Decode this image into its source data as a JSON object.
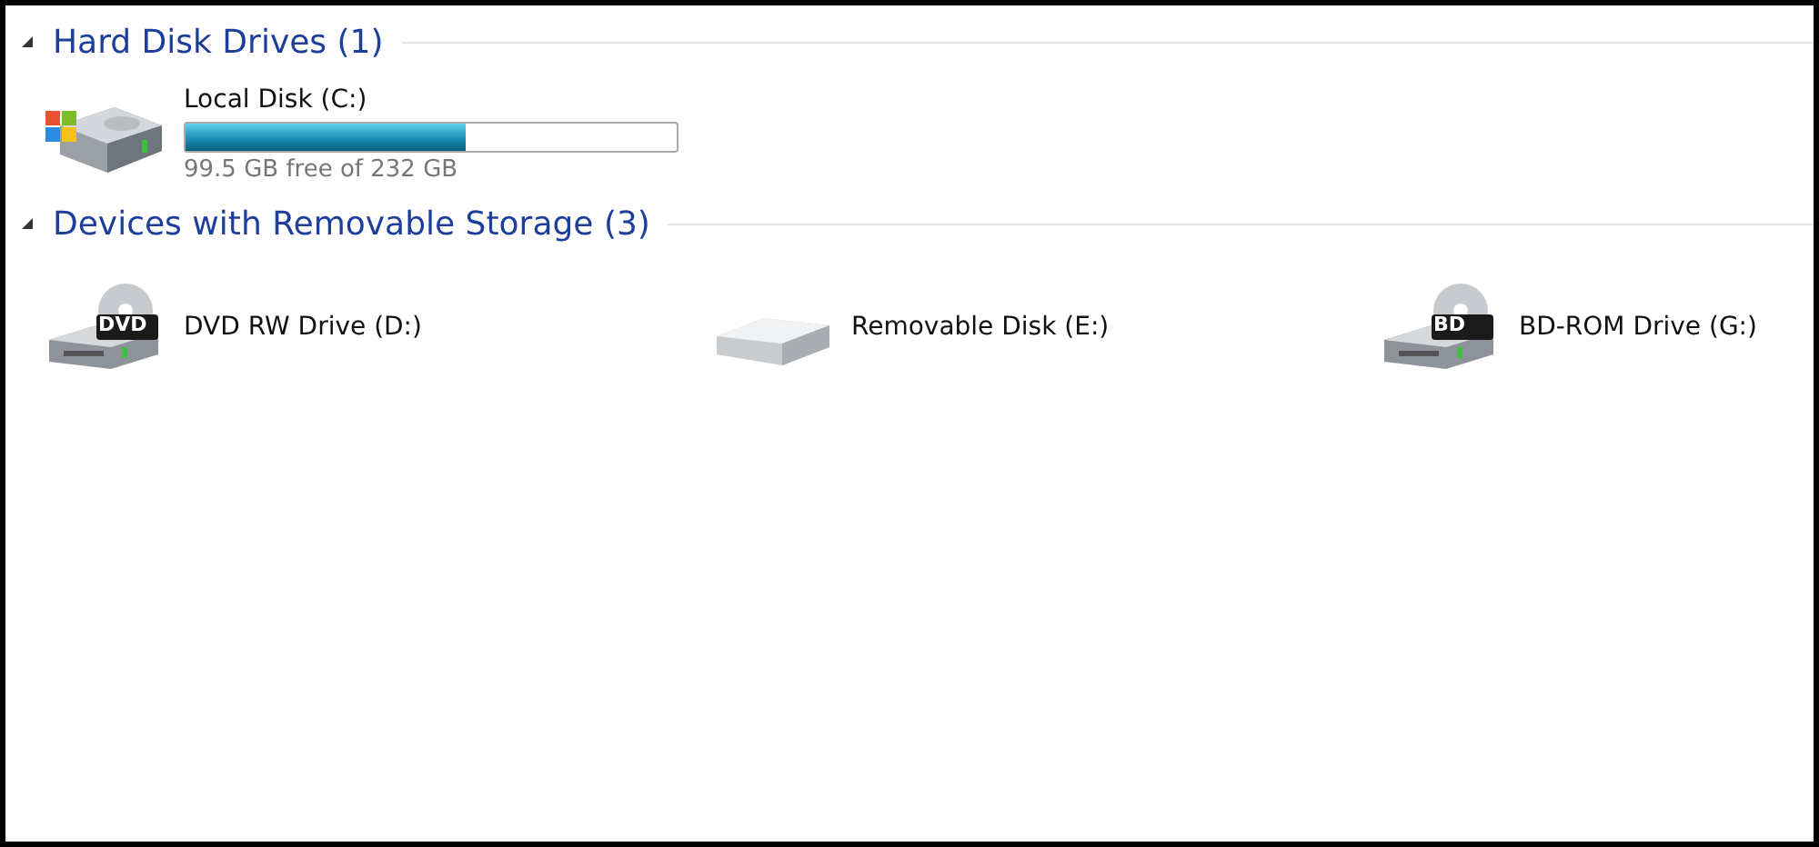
{
  "groups": [
    {
      "title": "Hard Disk Drives (1)",
      "expanded": true,
      "items": [
        {
          "kind": "hdd",
          "name": "Local Disk  (C:)",
          "level": 0.57,
          "free_text": "99.5 GB free of 232 GB"
        }
      ]
    },
    {
      "title": "Devices with Removable Storage (3)",
      "expanded": true,
      "items": [
        {
          "kind": "optical",
          "name": "DVD RW Drive (D:)",
          "disc_label": "DVD"
        },
        {
          "kind": "removable",
          "name": "Removable Disk (E:)"
        },
        {
          "kind": "optical",
          "name": "BD-ROM Drive (G:)",
          "disc_label": "BD"
        }
      ]
    }
  ]
}
